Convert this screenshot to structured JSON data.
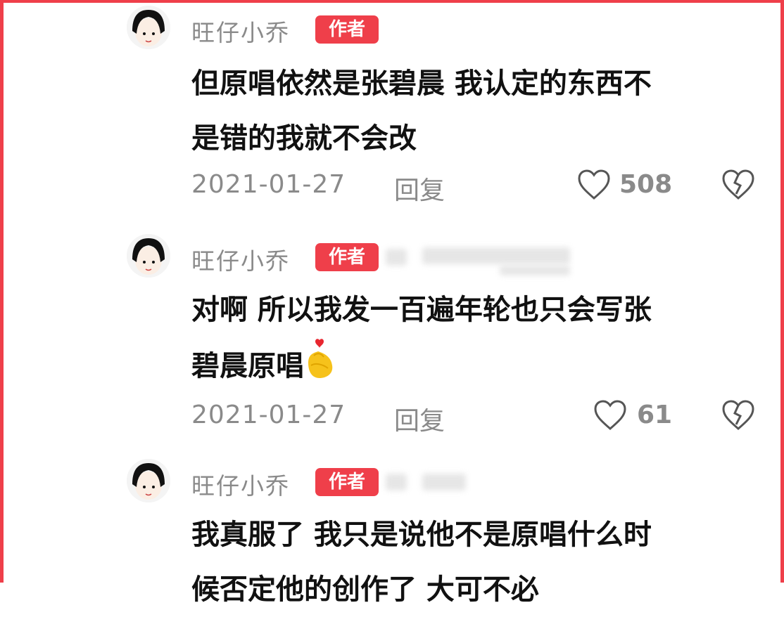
{
  "comments": [
    {
      "username": "旺仔小乔",
      "badge": "作者",
      "text_lines": [
        "但原唱依然是张碧晨 我认定的东西不",
        "是错的我就不会改"
      ],
      "date": "2021-01-27",
      "reply_label": "回复",
      "likes": "508"
    },
    {
      "username": "旺仔小乔",
      "badge": "作者",
      "text_lines": [
        "对啊 所以我发一百遍年轮也只会写张",
        "碧晨原唱"
      ],
      "date": "2021-01-27",
      "reply_label": "回复",
      "likes": "61"
    },
    {
      "username": "旺仔小乔",
      "badge": "作者",
      "text_lines": [
        "我真服了 我只是说他不是原唱什么时",
        "候否定他的创作了 大可不必"
      ]
    }
  ],
  "icons": {
    "like": "heart-outline-icon",
    "dislike": "broken-heart-icon",
    "emoji": "finger-heart-emoji"
  },
  "colors": {
    "accent": "#ef3f4a",
    "muted_text": "#8a8a8a",
    "body_text": "#111111"
  }
}
